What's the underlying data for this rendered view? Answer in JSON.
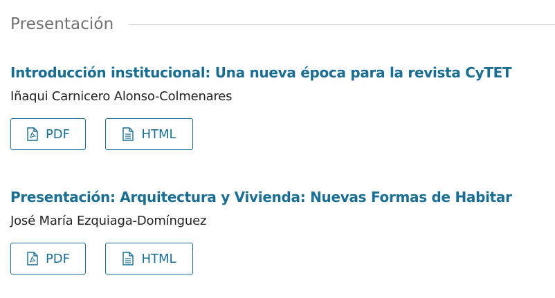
{
  "section": {
    "title": "Presentación"
  },
  "articles": [
    {
      "title": "Introducción institucional: Una nueva época para la revista CyTET",
      "author": "Iñaqui Carnicero Alonso-Colmenares",
      "galleys": [
        {
          "label": "PDF",
          "icon": "file-pdf-icon"
        },
        {
          "label": "HTML",
          "icon": "file-text-icon"
        }
      ]
    },
    {
      "title": "Presentación: Arquitectura y Vivienda: Nuevas Formas de Habitar",
      "author": "José María Ezquiaga-Domínguez",
      "galleys": [
        {
          "label": "PDF",
          "icon": "file-pdf-icon"
        },
        {
          "label": "HTML",
          "icon": "file-text-icon"
        }
      ]
    }
  ],
  "colors": {
    "link": "#1a6e94",
    "section_title": "#707070",
    "text": "#222222",
    "rule": "#dcdcdc"
  }
}
